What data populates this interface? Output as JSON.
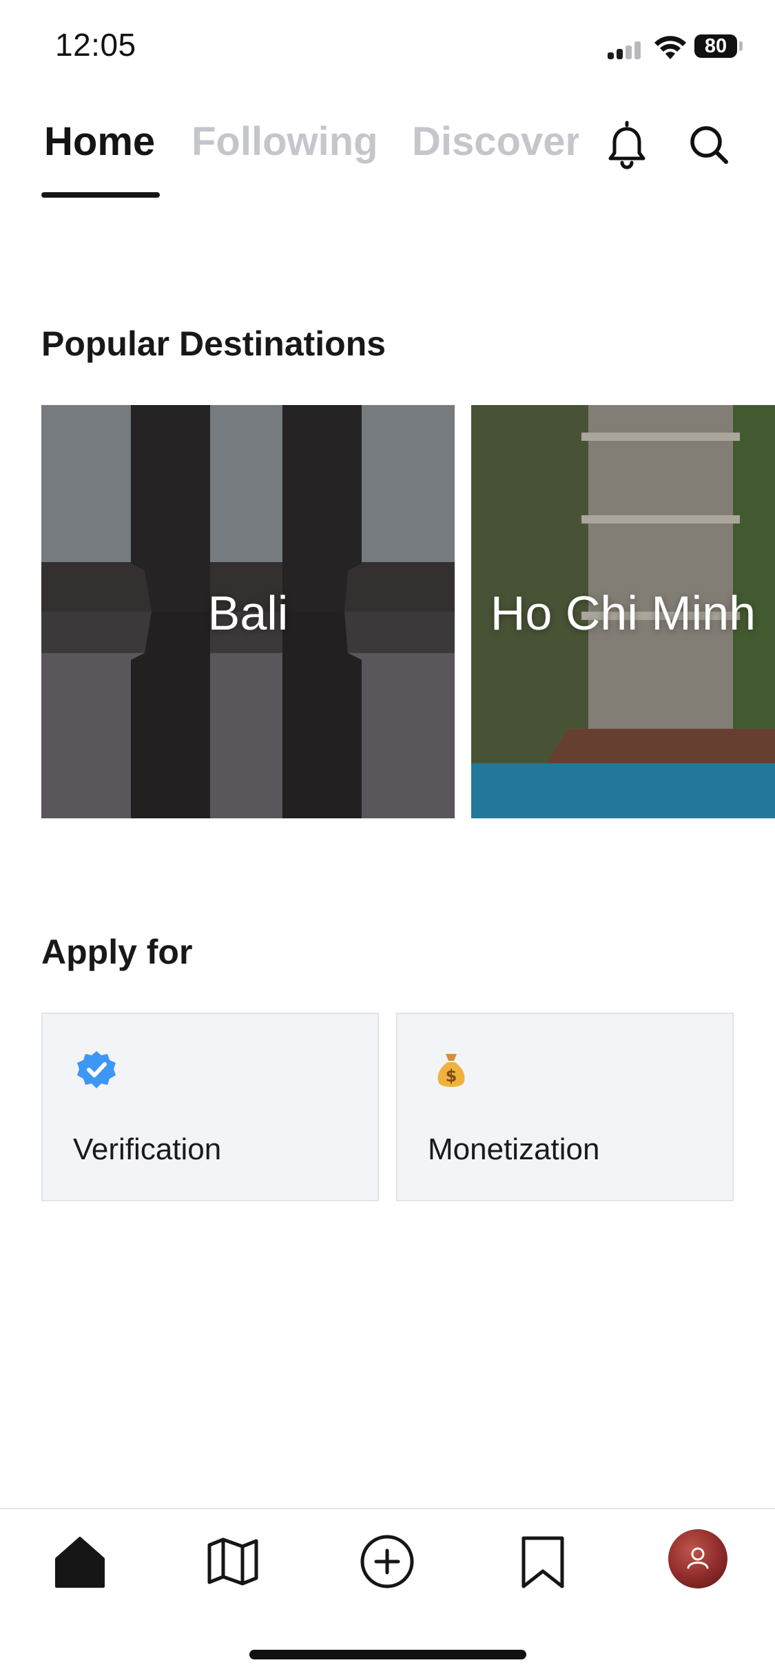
{
  "status_bar": {
    "time": "12:05",
    "battery": "80",
    "signal_icon": "cellular-signal-icon",
    "wifi_icon": "wifi-icon"
  },
  "tabs": [
    {
      "label": "Home",
      "active": true
    },
    {
      "label": "Following",
      "active": false
    },
    {
      "label": "Discover",
      "active": false
    }
  ],
  "header_icons": [
    "bell-icon",
    "search-icon"
  ],
  "popular": {
    "title": "Popular Destinations",
    "cards": [
      {
        "label": "Bali"
      },
      {
        "label": "Ho Chi Minh"
      }
    ]
  },
  "apply": {
    "title": "Apply for",
    "cards": [
      {
        "label": "Verification",
        "icon": "verified-badge-icon",
        "color": "#3d97f5"
      },
      {
        "label": "Monetization",
        "icon": "money-bag-icon",
        "color": "#e8a92b"
      }
    ]
  },
  "bottom_nav": {
    "items": [
      "home-icon",
      "map-icon",
      "add-circle-icon",
      "bookmark-icon",
      "profile-avatar"
    ]
  },
  "colors": {
    "active_text": "#141414",
    "inactive_tab": "#c4c6cc",
    "card_bg": "#f3f4f8"
  }
}
